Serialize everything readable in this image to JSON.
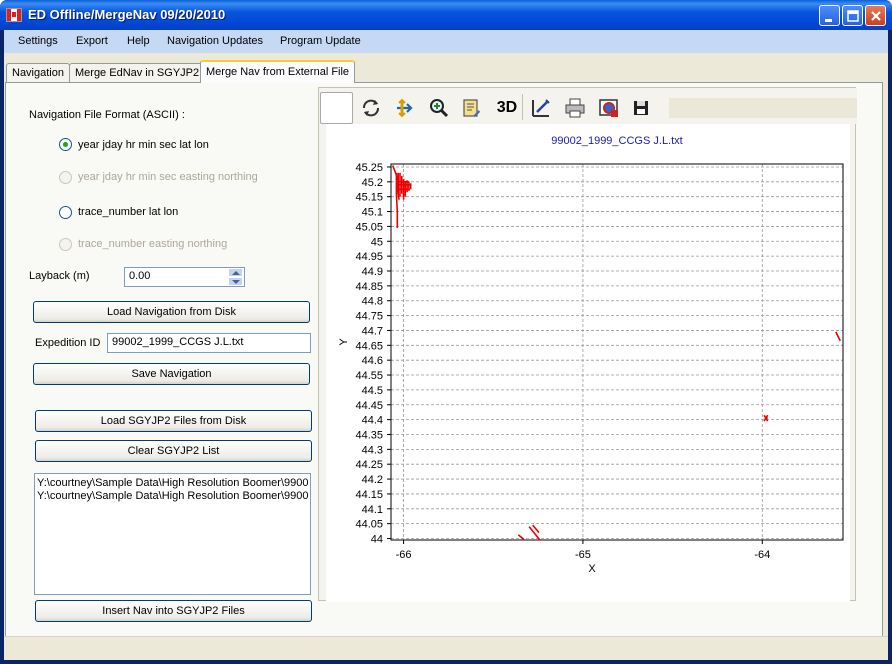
{
  "window": {
    "title": "ED Offline/MergeNav 09/20/2010",
    "minimize_icon": "minimize-icon",
    "maximize_icon": "maximize-icon",
    "close_icon": "close-icon"
  },
  "menu": {
    "items": [
      "Settings",
      "Export",
      "Help",
      "Navigation Updates",
      "Program Update"
    ]
  },
  "tabs": [
    "Navigation",
    "Merge EdNav in SGYJP2",
    "Merge Nav from External File"
  ],
  "active_tab": 2,
  "form": {
    "format_label": "Navigation File Format (ASCII) :",
    "formats": [
      {
        "label": "year jday hr min sec lat lon",
        "checked": true,
        "enabled": true
      },
      {
        "label": "year jday hr min sec easting northing",
        "checked": false,
        "enabled": false
      },
      {
        "label": "trace_number lat lon",
        "checked": false,
        "enabled": true
      },
      {
        "label": "trace_number easting northing",
        "checked": false,
        "enabled": false
      }
    ],
    "layback_label": "Layback (m)",
    "layback_value": "0.00",
    "load_nav_button": "Load Navigation from Disk",
    "expedition_label": "Expedition ID",
    "expedition_value": "99002_1999_CCGS J.L.txt",
    "save_nav_button": "Save Navigation",
    "load_sgy_button": "Load SGYJP2 Files from Disk",
    "clear_sgy_button": "Clear SGYJP2 List",
    "sgy_files": [
      "Y:\\courtney\\Sample Data\\High Resolution Boomer\\9900",
      "Y:\\courtney\\Sample Data\\High Resolution Boomer\\9900"
    ],
    "insert_button": "Insert Nav into SGYJP2 Files"
  },
  "toolbar": {
    "tools": [
      "rotate-icon",
      "pan-icon",
      "zoom-icon",
      "edit-icon",
      "3d-icon",
      "axis-edit-icon",
      "print-icon",
      "export-image-icon",
      "save-icon"
    ],
    "three_d_label": "3D"
  },
  "colors": {
    "track": "#ee0000",
    "title": "#1a1ab4",
    "grid": "#999999"
  },
  "chart_data": {
    "type": "scatter",
    "title": "99002_1999_CCGS J.L.txt",
    "xlabel": "X",
    "ylabel": "Y",
    "xlim": [
      -66.07,
      -63.55
    ],
    "ylim": [
      43.995,
      45.26
    ],
    "xticks": [
      -66,
      -65,
      -64
    ],
    "yticks": [
      45.25,
      45.2,
      45.15,
      45.1,
      45.05,
      45,
      44.95,
      44.9,
      44.85,
      44.8,
      44.75,
      44.7,
      44.65,
      44.6,
      44.55,
      44.5,
      44.45,
      44.4,
      44.35,
      44.3,
      44.25,
      44.2,
      44.15,
      44.1,
      44.05,
      44
    ],
    "grid": true,
    "series": [
      {
        "segments": [
          [
            [
              -66.06,
              45.255
            ],
            [
              -66.045,
              45.23
            ],
            [
              -66.035,
              45.215
            ],
            [
              -66.035,
              45.18
            ],
            [
              -66.03,
              45.16
            ]
          ],
          [
            [
              -66.04,
              45.23
            ],
            [
              -66.04,
              45.16
            ],
            [
              -66.035,
              45.1
            ],
            [
              -66.035,
              45.045
            ]
          ],
          [
            [
              -66.03,
              45.23
            ],
            [
              -66.03,
              45.16
            ],
            [
              -66.025,
              45.14
            ]
          ],
          [
            [
              -66.02,
              45.23
            ],
            [
              -66.02,
              45.15
            ]
          ],
          [
            [
              -66.01,
              45.22
            ],
            [
              -66.01,
              45.16
            ]
          ],
          [
            [
              -66.0,
              45.21
            ],
            [
              -66.0,
              45.14
            ]
          ],
          [
            [
              -65.99,
              45.2
            ],
            [
              -65.99,
              45.15
            ]
          ],
          [
            [
              -65.98,
              45.205
            ],
            [
              -65.98,
              45.165
            ]
          ],
          [
            [
              -65.97,
              45.2
            ],
            [
              -65.97,
              45.17
            ]
          ],
          [
            [
              -65.96,
              45.195
            ],
            [
              -65.96,
              45.175
            ]
          ],
          [
            [
              -66.04,
              45.19
            ],
            [
              -65.96,
              45.19
            ]
          ],
          [
            [
              -66.04,
              45.175
            ],
            [
              -65.965,
              45.175
            ]
          ],
          [
            [
              -66.04,
              45.2
            ],
            [
              -65.97,
              45.2
            ]
          ],
          [
            [
              -63.59,
              44.695
            ],
            [
              -63.565,
              44.665
            ]
          ],
          [
            [
              -63.99,
              44.415
            ],
            [
              -63.97,
              44.395
            ]
          ],
          [
            [
              -63.99,
              44.395
            ],
            [
              -63.97,
              44.415
            ]
          ],
          [
            [
              -63.985,
              44.405
            ],
            [
              -63.97,
              44.405
            ]
          ],
          [
            [
              -65.36,
              44.012
            ],
            [
              -65.33,
              43.998
            ]
          ],
          [
            [
              -65.3,
              44.04
            ],
            [
              -65.24,
              43.995
            ]
          ],
          [
            [
              -65.28,
              44.045
            ],
            [
              -65.245,
              44.02
            ]
          ]
        ]
      }
    ]
  }
}
